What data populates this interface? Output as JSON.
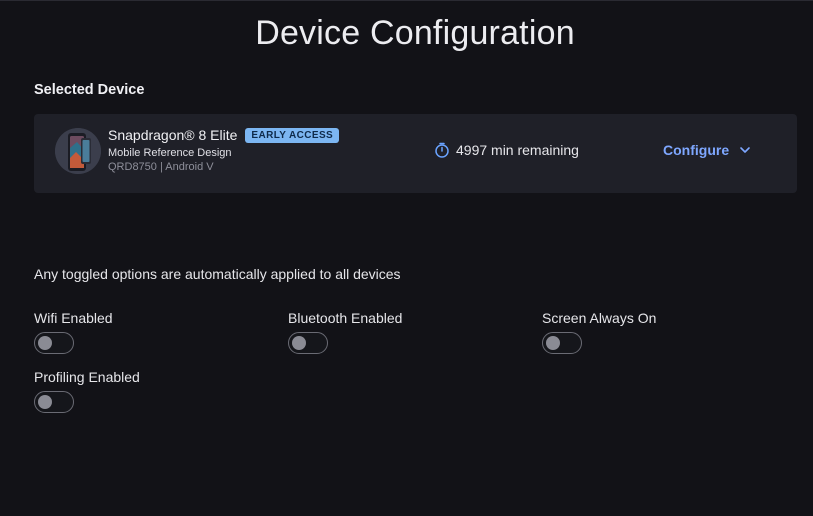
{
  "page": {
    "title": "Device Configuration"
  },
  "selected_device": {
    "heading": "Selected Device",
    "name": "Snapdragon® 8 Elite",
    "badge": "EARLY ACCESS",
    "subtitle": "Mobile Reference Design",
    "meta": "QRD8750 | Android V",
    "timer_text": "4997 min remaining",
    "configure_label": "Configure"
  },
  "toggles": {
    "note": "Any toggled options are automatically applied to all devices",
    "items": [
      {
        "label": "Wifi Enabled",
        "on": false
      },
      {
        "label": "Bluetooth Enabled",
        "on": false
      },
      {
        "label": "Screen Always On",
        "on": false
      },
      {
        "label": "Profiling Enabled",
        "on": false
      }
    ]
  },
  "colors": {
    "background": "#121217",
    "card": "#1f2028",
    "accent_link": "#7ea7ff",
    "badge_bg": "#7cb6f2",
    "timer_icon": "#6aa3ff"
  }
}
